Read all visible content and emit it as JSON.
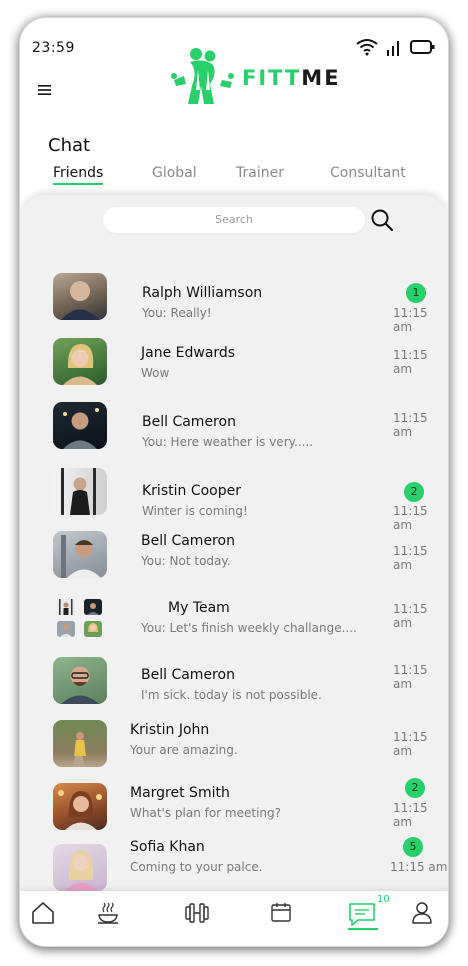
{
  "status": {
    "time": "23:59"
  },
  "app": {
    "name_part1": "FITT",
    "name_part2": "ME",
    "accent": "#27d06a"
  },
  "page": {
    "title": "Chat"
  },
  "tabs": [
    {
      "label": "Friends",
      "active": true
    },
    {
      "label": "Global",
      "active": false
    },
    {
      "label": "Trainer",
      "active": false
    },
    {
      "label": "Consultant",
      "active": false
    }
  ],
  "search": {
    "placeholder": "Search"
  },
  "chats": [
    {
      "name": "Ralph Williamson",
      "message": "You: Really!",
      "time": "11:15 am",
      "unread": "1"
    },
    {
      "name": "Jane Edwards",
      "message": "Wow",
      "time": "11:15 am",
      "unread": ""
    },
    {
      "name": "Bell Cameron",
      "message": "You: Here weather is very.....",
      "time": "11:15 am",
      "unread": ""
    },
    {
      "name": "Kristin Cooper",
      "message": "Winter is coming!",
      "time": "11:15 am",
      "unread": "2"
    },
    {
      "name": "Bell Cameron",
      "message": "You: Not today.",
      "time": "11:15 am",
      "unread": ""
    },
    {
      "name": "My Team",
      "message": "You: Let's finish weekly challange....",
      "time": "11:15 am",
      "unread": ""
    },
    {
      "name": "Bell Cameron",
      "message": "I'm sick. today is not possible.",
      "time": "11:15 am",
      "unread": ""
    },
    {
      "name": "Kristin John",
      "message": "Your are amazing.",
      "time": "11:15 am",
      "unread": ""
    },
    {
      "name": "Margret Smith",
      "message": "What's plan for meeting?",
      "time": "11:15 am",
      "unread": "2"
    },
    {
      "name": "Sofia Khan",
      "message": "Coming to your palce.",
      "time": "11:15 am",
      "unread": "5"
    }
  ],
  "bottom_nav": {
    "items": [
      "home-icon",
      "meal-icon",
      "dumbbell-icon",
      "calendar-icon",
      "chat-icon",
      "profile-icon"
    ],
    "chat_count": "10"
  }
}
